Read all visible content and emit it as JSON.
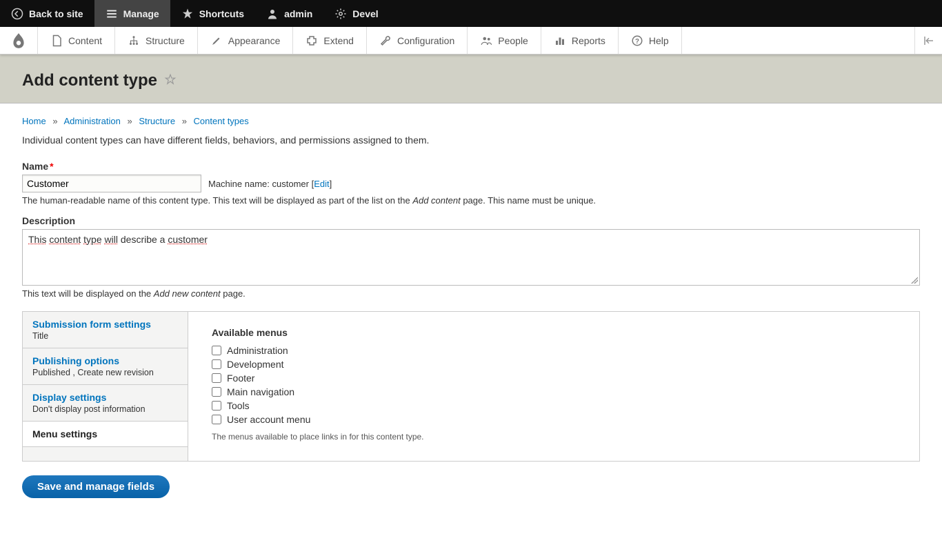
{
  "toolbar": {
    "back_to_site": "Back to site",
    "manage": "Manage",
    "shortcuts": "Shortcuts",
    "admin": "admin",
    "devel": "Devel"
  },
  "admin_menu": {
    "content": "Content",
    "structure": "Structure",
    "appearance": "Appearance",
    "extend": "Extend",
    "configuration": "Configuration",
    "people": "People",
    "reports": "Reports",
    "help": "Help"
  },
  "page": {
    "title": "Add content type"
  },
  "breadcrumbs": {
    "home": "Home",
    "administration": "Administration",
    "structure": "Structure",
    "content_types": "Content types"
  },
  "intro": "Individual content types can have different fields, behaviors, and permissions assigned to them.",
  "name_field": {
    "label": "Name",
    "value": "Customer",
    "machine_prefix": "Machine name: ",
    "machine_value": "customer",
    "edit_link": "Edit",
    "help_pre": "The human-readable name of this content type. This text will be displayed as part of the list on the ",
    "help_em": "Add content",
    "help_post": " page. This name must be unique."
  },
  "description_field": {
    "label": "Description",
    "value": "This content type will describe a customer",
    "help_pre": "This text will be displayed on the ",
    "help_em": "Add new content",
    "help_post": " page."
  },
  "tabs": [
    {
      "title": "Submission form settings",
      "summary": "Title"
    },
    {
      "title": "Publishing options",
      "summary": "Published , Create new revision"
    },
    {
      "title": "Display settings",
      "summary": "Don't display post information"
    },
    {
      "title": "Menu settings",
      "summary": ""
    }
  ],
  "menu_panel": {
    "heading": "Available menus",
    "items": [
      "Administration",
      "Development",
      "Footer",
      "Main navigation",
      "Tools",
      "User account menu"
    ],
    "help": "The menus available to place links in for this content type."
  },
  "submit_label": "Save and manage fields"
}
